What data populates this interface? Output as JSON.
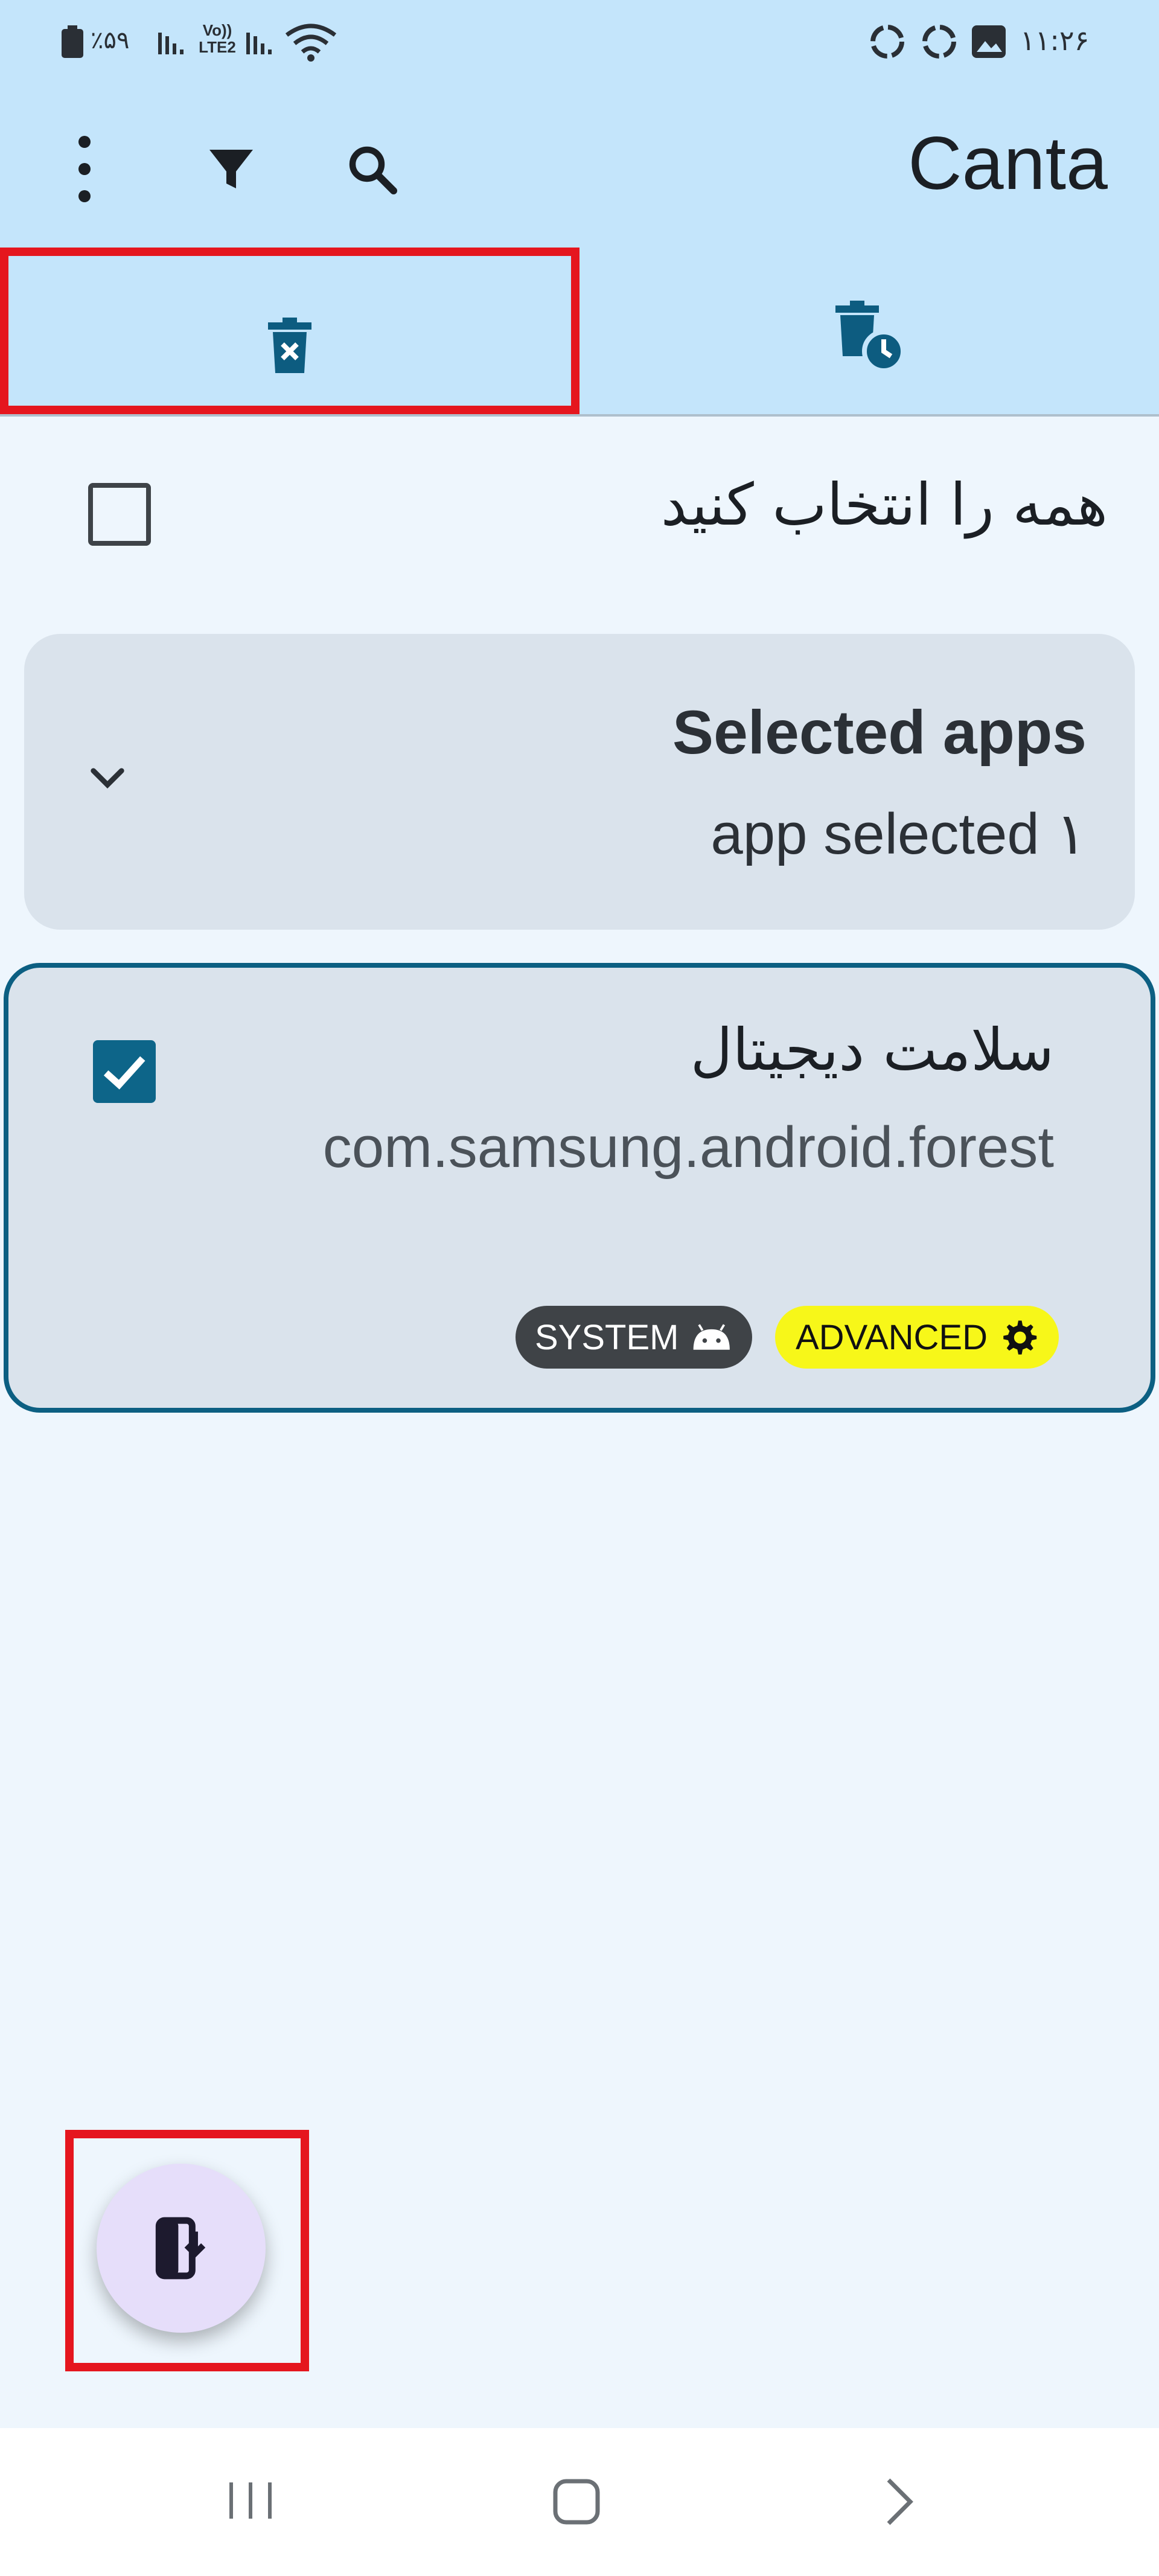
{
  "status_bar": {
    "time": "۱۱:۲۶",
    "battery": "٪۵۹",
    "network_label": "Vo)) LTE2",
    "icons": [
      "battery-icon",
      "signal-icon",
      "wifi-icon",
      "sync-icon",
      "sync-icon",
      "gallery-icon"
    ]
  },
  "app_bar": {
    "title": "Canta",
    "actions": [
      "more-vert-icon",
      "filter-icon",
      "search-icon"
    ]
  },
  "tabs": [
    {
      "name": "uninstall",
      "icon": "delete-x-icon",
      "selected": true
    },
    {
      "name": "restore",
      "icon": "delete-clock-icon",
      "selected": false
    }
  ],
  "select_all": {
    "label": "همه را انتخاب کنید",
    "checked": false
  },
  "selected_panel": {
    "title": "Selected apps",
    "subtitle": "app selected ۱",
    "icon": "chevron-down-icon"
  },
  "app_list": [
    {
      "name": "سلامت دیجیتال",
      "package": "com.samsung.android.forest",
      "checked": true,
      "badges": [
        {
          "label": "SYSTEM",
          "icon": "android-icon",
          "color": "#3f4347"
        },
        {
          "label": "ADVANCED",
          "icon": "gear-icon",
          "color": "#f7f719"
        }
      ]
    }
  ],
  "fab": {
    "icon": "phone-download-icon"
  },
  "colors": {
    "app_bar_bg": "#c4e5fb",
    "accent": "#0c5f82",
    "highlight": "#e5161e",
    "fab_bg": "#e6defa"
  }
}
